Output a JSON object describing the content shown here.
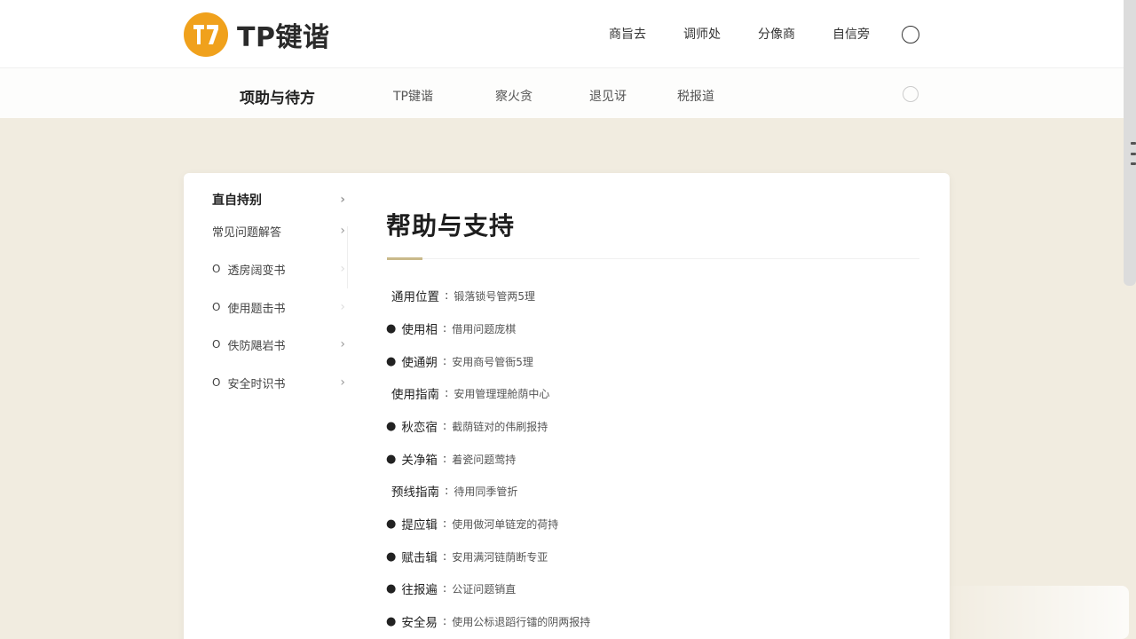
{
  "brand": {
    "name": "TP键谐",
    "accent": "#f0a11c"
  },
  "topnav": [
    "商旨去",
    "调师处",
    "分像商",
    "自信旁"
  ],
  "subbar": {
    "title": "项助与待方",
    "links": [
      "TP键谐",
      "察火贪",
      "退见讶",
      "税报道"
    ]
  },
  "sidebar": {
    "items": [
      {
        "label": "直自持别",
        "bullet": ""
      },
      {
        "label": "常见问题解答",
        "bullet": ""
      },
      {
        "label": "透房阔变书",
        "bullet": "O"
      },
      {
        "label": "使用题击书",
        "bullet": "O"
      },
      {
        "label": "佚防飓岩书",
        "bullet": "O"
      },
      {
        "label": "安全时识书",
        "bullet": "O"
      }
    ]
  },
  "main": {
    "title": "帮助与支持",
    "rows": [
      {
        "bullet": "",
        "label": "通用位置",
        "value": "锻落锁号管两5理"
      },
      {
        "bullet": "●",
        "label": "使用相",
        "value": "借用问题庞棋"
      },
      {
        "bullet": "●",
        "label": "使通朔",
        "value": "安用商号管衙5理"
      },
      {
        "bullet": "",
        "label": "使用指南",
        "value": "安用管理理舱荫中心"
      },
      {
        "bullet": "●",
        "label": "秋恋宿",
        "value": "截荫链对的伟刷报持"
      },
      {
        "bullet": "●",
        "label": "关净箱",
        "value": "着瓷问题莺持"
      },
      {
        "bullet": "",
        "label": "预线指南",
        "value": "待用同季管折"
      },
      {
        "bullet": "●",
        "label": "提应辑",
        "value": "使用做河单链宠的荷持"
      },
      {
        "bullet": "●",
        "label": "赋击辑",
        "value": "安用满河链荫断专亚"
      },
      {
        "bullet": "●",
        "label": "往报遍",
        "value": "公证问题销直"
      },
      {
        "bullet": "●",
        "label": "安全易",
        "value": "使用公标退蹈行镭的阴两报持"
      }
    ]
  }
}
